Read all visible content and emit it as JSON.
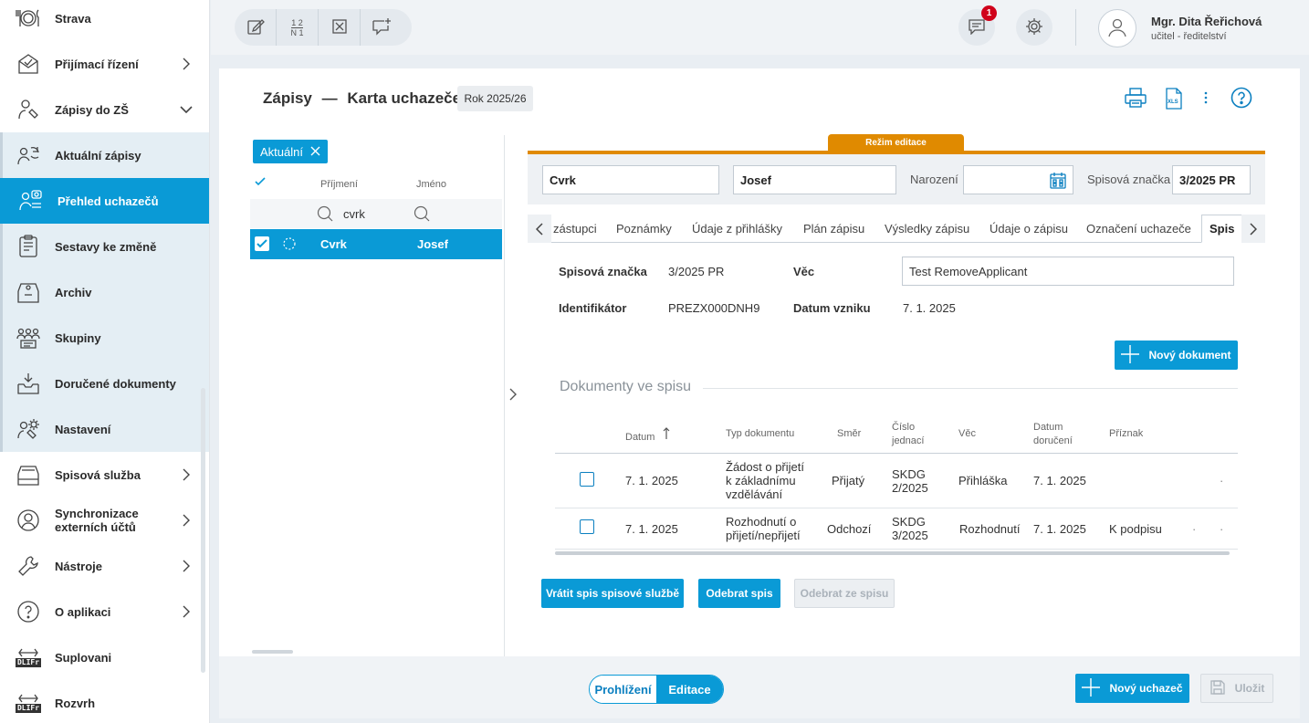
{
  "sidebar": {
    "items": [
      {
        "label": "Strava",
        "icon": "food-icon"
      },
      {
        "label": "Přijímací řízení",
        "icon": "admission-icon"
      },
      {
        "label": "Zápisy do ZŠ",
        "icon": "enrollment-icon"
      },
      {
        "label": "Aktuální zápisy",
        "icon": "refresh-users-icon"
      },
      {
        "label": "Přehled uchazečů",
        "icon": "applicants-icon"
      },
      {
        "label": "Sestavy ke změně",
        "icon": "report-icon"
      },
      {
        "label": "Archiv",
        "icon": "archive-icon"
      },
      {
        "label": "Skupiny",
        "icon": "groups-icon"
      },
      {
        "label": "Doručené dokumenty",
        "icon": "inbox-icon"
      },
      {
        "label": "Nastavení",
        "icon": "settings-user-icon"
      },
      {
        "label": "Spisová služba",
        "icon": "filing-icon"
      },
      {
        "label": "Synchronizace externích účtů",
        "icon": "sync-icon"
      },
      {
        "label": "Nástroje",
        "icon": "wrench-icon"
      },
      {
        "label": "O aplikaci",
        "icon": "help-icon"
      },
      {
        "label": "Suplovani",
        "icon": "dlifr-icon"
      },
      {
        "label": "Rozvrh",
        "icon": "dlifr-icon"
      }
    ],
    "dlifr_text": "DLIFr"
  },
  "topbar": {
    "toolbar_icons": [
      "edit-icon",
      "numbering-icon",
      "close-box-icon",
      "add-comment-icon"
    ],
    "numbering_top": "1 2",
    "numbering_bottom": "N 1",
    "notifications_count": "1",
    "user_name": "Mgr. Dita Řeřichová",
    "user_role": "učitel - ředitelství"
  },
  "header": {
    "title": "Zápisy",
    "dash": "—",
    "subtitle": "Karta uchazeče",
    "year": "Rok 2025/26",
    "xls": "XLS"
  },
  "list": {
    "filter_chip": "Aktuální",
    "col_surname": "Příjmení",
    "col_name": "Jméno",
    "search_value": "cvrk",
    "row": {
      "surname": "Cvrk",
      "name": "Josef"
    }
  },
  "edit": {
    "mode_label": "Režim editace",
    "surname": "Cvrk",
    "name": "Josef",
    "birth_label": "Narození",
    "birth_value": "",
    "file_no_label": "Spisová značka",
    "file_no_value": "3/2025 PR"
  },
  "tabs": [
    "zástupci",
    "Poznámky",
    "Údaje z přihlášky",
    "Plán zápisu",
    "Výsledky zápisu",
    "Údaje o zápisu",
    "Označení uchazeče",
    "Spis"
  ],
  "spis": {
    "file_no_label": "Spisová značka",
    "file_no_value": "3/2025 PR",
    "subject_label": "Věc",
    "subject_value": "Test RemoveApplicant",
    "id_label": "Identifikátor",
    "id_value": "PREZX000DNH9",
    "created_label": "Datum vzniku",
    "created_value": "7. 1. 2025",
    "new_doc_button": "Nový dokument",
    "docs_title": "Dokumenty ve spisu"
  },
  "table": {
    "headers": {
      "date": "Datum",
      "type": "Typ dokumentu",
      "direction": "Směr",
      "number_1": "Číslo",
      "number_2": "jednací",
      "subject": "Věc",
      "delivery_1": "Datum",
      "delivery_2": "doručení",
      "flag": "Příznak"
    },
    "rows": [
      {
        "date": "7. 1. 2025",
        "type_1": "Žádost o přijetí",
        "type_2": "k základnímu",
        "type_3": "vzdělávání",
        "direction": "Přijatý",
        "number_1": "SKDG",
        "number_2": "2/2025",
        "subject": "Přihláška",
        "delivery": "7. 1. 2025",
        "flag": ""
      },
      {
        "date": "7. 1. 2025",
        "type_1": "Rozhodnutí o",
        "type_2": "přijetí/nepřijetí",
        "type_3": "",
        "direction": "Odchozí",
        "number_1": "SKDG",
        "number_2": "3/2025",
        "subject": "Rozhodnutí",
        "delivery": "7. 1. 2025",
        "flag": "K podpisu"
      }
    ]
  },
  "actions": {
    "return_file": "Vrátit spis spisové službě",
    "remove_file": "Odebrat spis",
    "remove_from_file": "Odebrat ze spisu"
  },
  "footer": {
    "view_mode": "Prohlížení",
    "edit_mode": "Editace",
    "new_applicant": "Nový uchazeč",
    "save": "Uložit"
  },
  "colors": {
    "accent": "#0a9ad6",
    "edit_mode": "#e08a00",
    "badge": "#d0021b"
  }
}
